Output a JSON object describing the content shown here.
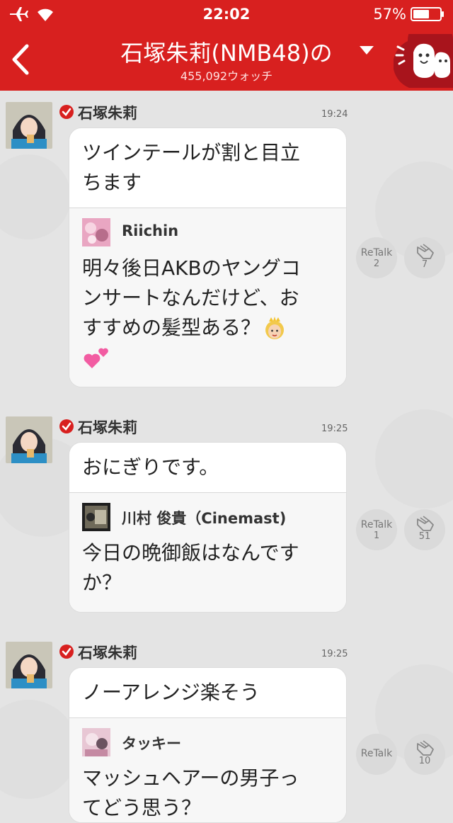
{
  "status_bar": {
    "time": "22:02",
    "battery": "57%"
  },
  "header": {
    "title": "石塚朱莉(NMB48)の",
    "subtitle": "455,092ウォッチ"
  },
  "messages": [
    {
      "author": "石塚朱莉",
      "time": "19:24",
      "reply_lines": [
        "ツインテールが割と目立",
        "ちます"
      ],
      "quote_author": "Riichin",
      "quote_lines": [
        "明々後日AKBのヤングコ",
        "ンサートなんだけど、お",
        "すすめの髪型ある？"
      ],
      "retalk_label": "ReTalk",
      "retalk_count": "2",
      "clap_count": "7"
    },
    {
      "author": "石塚朱莉",
      "time": "19:25",
      "reply_lines": [
        "おにぎりです。"
      ],
      "quote_author": "川村 俊貴（Cinemast)",
      "quote_lines": [
        "今日の晩御飯はなんです",
        "か？"
      ],
      "retalk_label": "ReTalk",
      "retalk_count": "1",
      "clap_count": "51"
    },
    {
      "author": "石塚朱莉",
      "time": "19:25",
      "reply_lines": [
        "ノーアレンジ楽そう"
      ],
      "quote_author": "タッキー",
      "quote_lines": [
        "マッシュヘアーの男子っ",
        "てどう思う？"
      ],
      "retalk_label": "ReTalk",
      "retalk_count": "",
      "clap_count": "10"
    }
  ],
  "colors": {
    "brand_red": "#d8201f",
    "verified_red": "#d8201f"
  }
}
